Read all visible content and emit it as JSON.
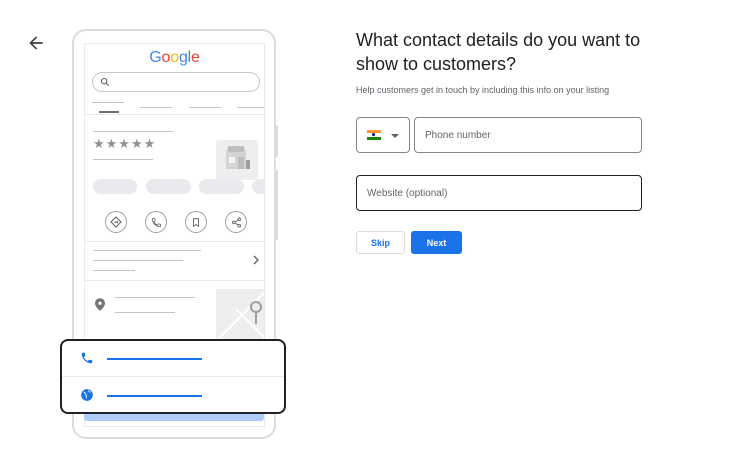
{
  "nav": {
    "back_icon": "arrow-left-icon"
  },
  "illustration": {
    "logo_text": "Google",
    "logo_colors": [
      "#4285F4",
      "#EA4335",
      "#FBBC05",
      "#4285F4",
      "#34A853",
      "#EA4335"
    ],
    "stars": "★★★★★",
    "action_icons": [
      "directions-icon",
      "phone-icon",
      "bookmark-icon",
      "share-icon"
    ],
    "card_icons": [
      "phone-icon",
      "globe-icon"
    ]
  },
  "form": {
    "title": "What contact details do you want to show to customers?",
    "subtitle": "Help customers get in touch by including this info on your listing",
    "country_flag": "india-flag-icon",
    "phone_placeholder": "Phone number",
    "website_placeholder": "Website (optional)",
    "skip_label": "Skip",
    "next_label": "Next"
  },
  "colors": {
    "accent": "#1a73e8",
    "accent_light": "#aecbfa",
    "flag_saffron": "#FF9933",
    "flag_white": "#FFFFFF",
    "flag_green": "#138808"
  }
}
